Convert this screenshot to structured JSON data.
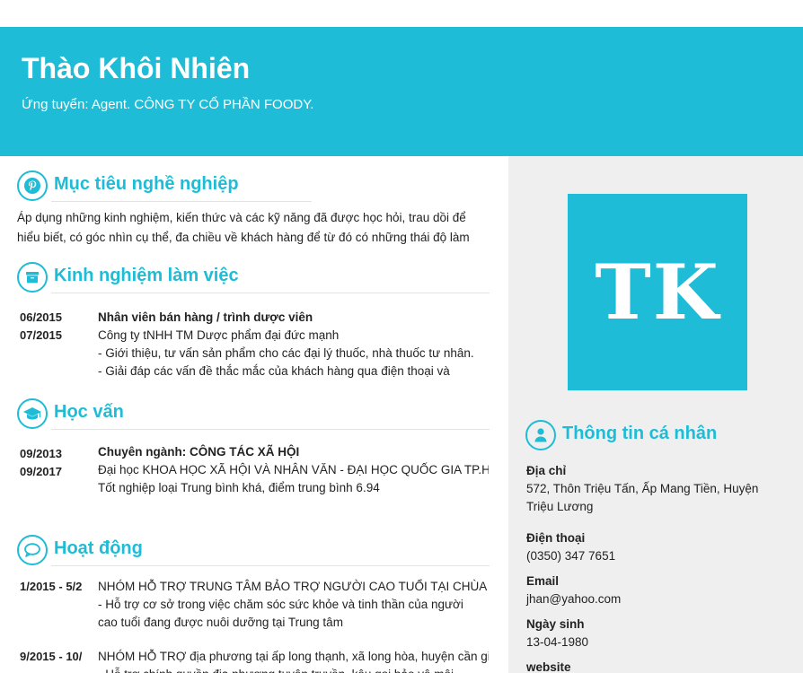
{
  "header": {
    "name": "Thào Khôi Nhiên",
    "applying": "Ứng tuyển: Agent. CÔNG TY CỔ PHẦN FOODY."
  },
  "objective": {
    "title": "Mục tiêu nghề nghiệp",
    "icon": "pinterest-icon",
    "lines": [
      "Áp dụng những kinh nghiệm, kiến thức và các kỹ năng đã được học hỏi, trau dồi để",
      "hiểu biết, có góc nhìn cụ thể, đa chiều về khách hàng để từ đó có những thái độ làm"
    ]
  },
  "experience": {
    "title": "Kinh nghiệm làm việc",
    "icon": "archive-box-icon",
    "items": [
      {
        "start": "06/2015",
        "end": "07/2015",
        "position": "Nhân viên bán hàng / trình dược viên",
        "company": "Công ty tNHH TM Dược phẩm đại đức mạnh",
        "bullet1": "- Giới thiệu, tư vấn sản phẩm cho các đại lý thuốc, nhà thuốc tư nhân.",
        "bullet2": "- Giải đáp các vấn đề thắc mắc của khách hàng qua điện thoại và"
      }
    ]
  },
  "education": {
    "title": "Học vấn",
    "icon": "graduation-cap-icon",
    "items": [
      {
        "start": "09/2013",
        "end": "09/2017",
        "major": "Chuyên ngành: CÔNG TÁC XÃ HỘI",
        "school": "Đại học KHOA HỌC XÃ HỘI VÀ NHÂN VĂN - ĐẠI HỌC QUỐC GIA TP.HCM",
        "result": "Tốt nghiệp loại Trung bình khá, điểm trung bình 6.94"
      }
    ]
  },
  "activities": {
    "title": "Hoạt động",
    "icon": "chat-bubble-icon",
    "items": [
      {
        "date": "1/2015  - 5/2",
        "title": "NHÓM HỖ TRỢ TRUNG TÂM BẢO TRỢ NGƯỜI CAO TUỔI TẠI CHÙA",
        "line1": "- Hỗ trợ cơ sở trong việc chăm sóc sức khỏe và tinh thần của người",
        "line2": "cao tuổi đang được nuôi dưỡng tại Trung tâm"
      },
      {
        "date": "9/2015  - 10/",
        "title": "NHÓM HỖ TRỢ địa phương tại ấp long thạnh, xã long hòa, huyện cần giờ",
        "line1": "- Hỗ trợ chính quyền địa phương tuyên truyền, kêu gọi bảo vệ môi"
      }
    ]
  },
  "sidebar": {
    "initials": "TK",
    "personal_title": "Thông tin cá nhân",
    "icon": "user-icon",
    "address_label": "Địa chỉ",
    "address_line1": "572, Thôn Triệu Tấn, Ấp Mang Tiền, Huyện",
    "address_line2": "Triệu Lương",
    "phone_label": "Điện thoại",
    "phone": "(0350) 347 7651",
    "email_label": "Email",
    "email": "jhan@yahoo.com",
    "birthday_label": "Ngày sinh",
    "birthday": "13-04-1980",
    "website_label": "website"
  },
  "colors": {
    "accent": "#1ebcd6",
    "sidebar_bg": "#efefef"
  }
}
